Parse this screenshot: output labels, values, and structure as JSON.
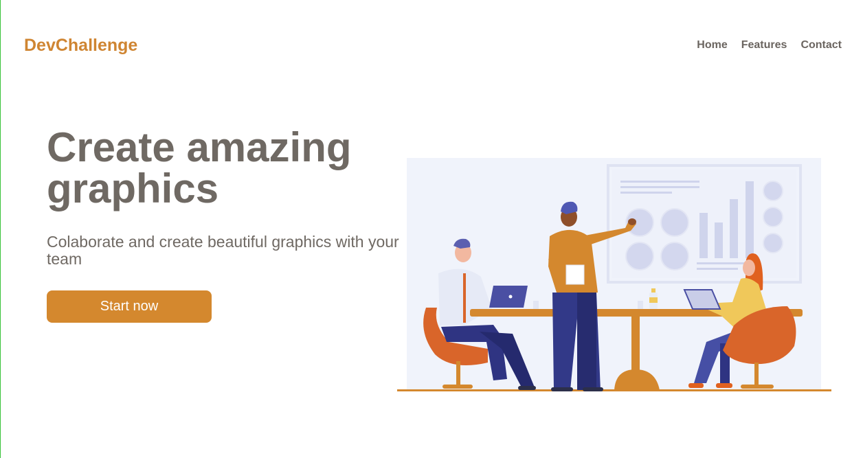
{
  "header": {
    "brand": "DevChallenge",
    "nav": [
      {
        "label": "Home"
      },
      {
        "label": "Features"
      },
      {
        "label": "Contact"
      }
    ]
  },
  "hero": {
    "title": "Create amazing graphics",
    "subtitle": "Colaborate and create beautiful graphics with your team",
    "cta_label": "Start now"
  },
  "illustration": {
    "icon": "team-meeting-illustration"
  },
  "colors": {
    "accent": "#d4882e",
    "brand": "#cf8532",
    "text": "#6f6963",
    "nav_text": "#6b6560",
    "illustration_bg": "#f0f3fb"
  }
}
